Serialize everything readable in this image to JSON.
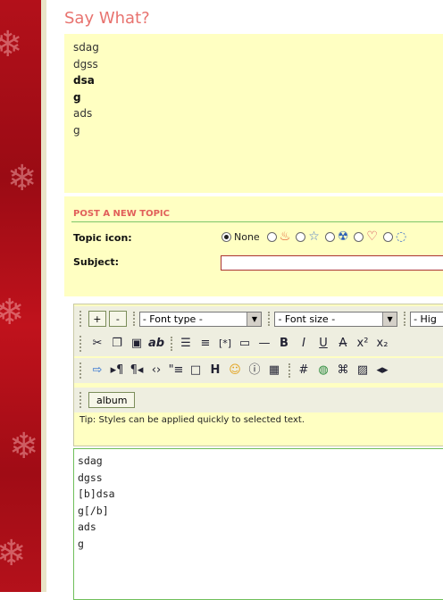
{
  "page": {
    "title": "Say What?"
  },
  "preview": {
    "lines": [
      {
        "text": "sdag",
        "bold": false
      },
      {
        "text": "dgss",
        "bold": false
      },
      {
        "text": "dsa",
        "bold": true
      },
      {
        "text": "g",
        "bold": true
      },
      {
        "text": "ads",
        "bold": false
      },
      {
        "text": "g",
        "bold": false
      }
    ]
  },
  "form": {
    "heading": "POST A NEW TOPIC",
    "topic_icon_label": "Topic icon:",
    "subject_label": "Subject:",
    "subject_value": "",
    "icon_options": [
      {
        "name": "none",
        "label": "None",
        "selected": true,
        "icon": "none"
      },
      {
        "name": "flame",
        "label": "",
        "selected": false,
        "icon": "flame-icon"
      },
      {
        "name": "star",
        "label": "",
        "selected": false,
        "icon": "star-icon"
      },
      {
        "name": "radioactive",
        "label": "",
        "selected": false,
        "icon": "radioactive-icon"
      },
      {
        "name": "heart",
        "label": "",
        "selected": false,
        "icon": "heart-icon"
      },
      {
        "name": "speech",
        "label": "",
        "selected": false,
        "icon": "speech-bubble-icon"
      }
    ]
  },
  "toolbar": {
    "plus_label": "+",
    "minus_label": "-",
    "font_type": "- Font type -",
    "font_size": "- Font size -",
    "highlight": "- Hig",
    "album_label": "album",
    "tip": "Tip: Styles can be applied quickly to selected text."
  },
  "editor": {
    "content": "sdag\ndgss\n[b]dsa\ng[/b]\nads\ng"
  },
  "colors": {
    "sidebar": "#b3101a",
    "panel": "#ffffc2",
    "title": "#e8736f",
    "heading": "#e15f5a"
  }
}
